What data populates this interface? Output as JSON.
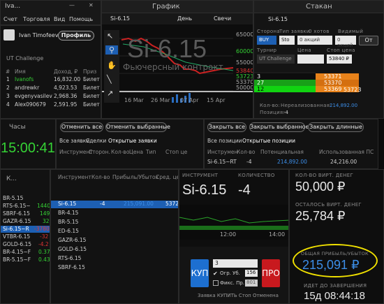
{
  "topbar": {
    "app": "Iva...",
    "menu": [
      "Счет",
      "Торговля",
      "Вид",
      "Помощь"
    ]
  },
  "user": {
    "name": "Ivan Timofeev",
    "profile_btn": "Профиль"
  },
  "challenge": {
    "title": "UT Challenge",
    "headers": [
      "#",
      "Имя",
      "Доход, ₽",
      "Приз"
    ],
    "rows": [
      {
        "n": "1",
        "name": "Ivanofs",
        "income": "16,832.00",
        "prize": "Билет"
      },
      {
        "n": "2",
        "name": "andrewkr",
        "income": "4,923.53",
        "prize": "Билет"
      },
      {
        "n": "3",
        "name": "evgenyvasilev",
        "income": "2,968.36",
        "prize": "Билет"
      },
      {
        "n": "4",
        "name": "Alex090679",
        "income": "2,591.95",
        "prize": "Билет"
      }
    ]
  },
  "chart": {
    "title": "График",
    "symbol": "Si-6.15",
    "period": "День",
    "type": "Свечи",
    "watermark": "Si-6.15",
    "subtitle": "Фьючерсный контракт",
    "prices": [
      "65000",
      "60000",
      "55000",
      "53840",
      "53723",
      "53370",
      "50000"
    ],
    "dates": [
      "16 Mar",
      "26 Mar",
      "07 Apr",
      "15 Apr"
    ],
    "vol": "1996"
  },
  "orderbook": {
    "title": "Стакан",
    "symbol": "Si-6.15",
    "side_label": "Сторона",
    "type_label": "Тип заявки",
    "hidden_label": "0 хотов",
    "visible_label": "Видимый",
    "side": "BUY",
    "type": "Sto",
    "zero1": "0 акций",
    "zero2": "0 акций",
    "ot": "От",
    "turnir_label": "Турнир",
    "price_label": "Цена",
    "stop_label": "Стоп цена",
    "turnir": "UT Challenge",
    "stop_price": "53840 ₽",
    "bids": [
      {
        "q": "3",
        "p": "53371"
      },
      {
        "q": "27",
        "p": "53370"
      },
      {
        "q": "12",
        "p": "53369"
      }
    ],
    "ask_val": "53723",
    "qty_label": "Кол-во:",
    "unfilled_label": "Нереализованная:",
    "unfilled": "214,892.00",
    "pos_label": "Позиция:",
    "pos": "-4"
  },
  "clock": {
    "title": "Часы",
    "time": "15:00:41"
  },
  "orders": {
    "btn1": "Отменить все",
    "btn2": "Отменить выбранные",
    "tabs": [
      "Все заявки",
      "Сделки",
      "Открытые заявки"
    ],
    "headers": [
      "Инструмент",
      "Сторон.",
      "Кол-во",
      "Цена",
      "Тип",
      "Стоп це"
    ]
  },
  "positions": {
    "btn1": "Закрыть все",
    "btn2": "Закрыть выбранное",
    "btn3": "Закрыть длинные",
    "tabs": [
      "Все позиции",
      "Открытые позиции"
    ],
    "headers": [
      "Инструмен",
      "Кол-во",
      "Потенциальная",
      "Использованная ПС"
    ],
    "row": {
      "sym": "Si-6.15~RT",
      "qty": "-4",
      "pot": "214,892.00",
      "used": "24,216.00"
    }
  },
  "watch": {
    "title": "К...",
    "items": [
      {
        "s": "BR-5.15",
        "v": ""
      },
      {
        "s": "RTS-6.15~",
        "v": "1440"
      },
      {
        "s": "SBRF-6.15",
        "v": "149"
      },
      {
        "s": "GAZR-6.15",
        "v": "32"
      },
      {
        "s": "Si-6.15~R",
        "v": "-3780"
      },
      {
        "s": "VTBR-6.15",
        "v": "-32"
      },
      {
        "s": "GOLD-6.15",
        "v": "-4.2"
      },
      {
        "s": "BR-4.15~F",
        "v": "0.37"
      },
      {
        "s": "BR-5.15~F",
        "v": "0.43"
      }
    ]
  },
  "pnl": {
    "headers": [
      "Инструмент",
      "Кол-во",
      "Прибыль/Убыток",
      "Сред. цена"
    ],
    "rows": [
      {
        "s": "Si-6.15",
        "q": "-4",
        "p": "215,091.00",
        "a": "53723"
      },
      {
        "s": "BR-4.15",
        "q": "",
        "p": "",
        "a": ""
      },
      {
        "s": "BR-5.15",
        "q": "",
        "p": "",
        "a": ""
      },
      {
        "s": "ED-6.15",
        "q": "",
        "p": "",
        "a": ""
      },
      {
        "s": "GAZR-6.15",
        "q": "",
        "p": "",
        "a": ""
      },
      {
        "s": "GOLD-6.15",
        "q": "",
        "p": "",
        "a": ""
      },
      {
        "s": "RTS-6.15",
        "q": "",
        "p": "",
        "a": ""
      },
      {
        "s": "SBRF-6.15",
        "q": "",
        "p": "",
        "a": ""
      }
    ]
  },
  "trade": {
    "instr_label": "ИНСТРУМЕНТ",
    "qty_label": "КОЛИЧЕСТВО",
    "symbol": "Si-6.15",
    "qty": "-4",
    "buy": "КУП",
    "sell": "ПРО",
    "field": "3",
    "stop_label": "Огр. Уб.",
    "stop_val": "156",
    "fixed_label": "Фикс. Пр.",
    "fixed_val": "801",
    "status": "Заявка КУПИТЬ Стоп Отменена",
    "time1": "12:00",
    "time2": "14:00"
  },
  "account": {
    "virt_label": "КОЛ-ВО ВИРТ. ДЕНЕГ",
    "virt": "50,000 ₽",
    "left_label": "ОСТАЛОСЬ ВИРТ. ДЕНЕГ",
    "left": "25,784 ₽",
    "pnl_label": "ОБЩАЯ ПРИБЫЛЬ/УБЫТОК",
    "pnl": "215,091 ₽",
    "end_label": "ИДЕТ ДО ЗАВЕРШЕНИЯ",
    "end": "15д 08:44:18"
  },
  "colors": {
    "accent": "#1d5fb3",
    "green": "#35d235",
    "red": "#e03434",
    "highlight": "#f0e000"
  }
}
